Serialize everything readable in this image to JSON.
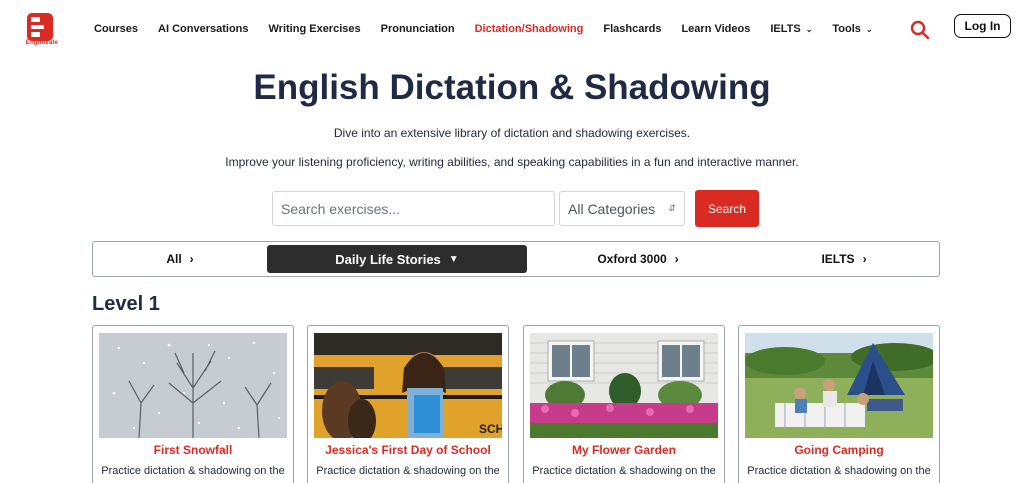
{
  "brand": {
    "name": "Engnovate",
    "accent": "#d92b22"
  },
  "nav": {
    "items": [
      {
        "label": "Courses"
      },
      {
        "label": "AI Conversations"
      },
      {
        "label": "Writing Exercises"
      },
      {
        "label": "Pronunciation"
      },
      {
        "label": "Dictation/Shadowing"
      },
      {
        "label": "Flashcards"
      },
      {
        "label": "Learn Videos"
      },
      {
        "label": "IELTS"
      },
      {
        "label": "Tools"
      }
    ],
    "login_label": "Log In"
  },
  "hero": {
    "title": "English Dictation & Shadowing",
    "subtitle1": "Dive into an extensive library of dictation and shadowing exercises.",
    "subtitle2": "Improve your listening proficiency, writing abilities, and speaking capabilities in a fun and interactive manner."
  },
  "search": {
    "placeholder": "Search exercises...",
    "category_value": "All Categories",
    "button_label": "Search"
  },
  "tabs": [
    {
      "label": "All"
    },
    {
      "label": "Daily Life Stories"
    },
    {
      "label": "Oxford 3000"
    },
    {
      "label": "IELTS"
    }
  ],
  "level_label": "Level 1",
  "cards": [
    {
      "title": "First Snowfall",
      "desc": "Practice dictation & shadowing on the"
    },
    {
      "title": "Jessica's First Day of School",
      "desc": "Practice dictation & shadowing on the"
    },
    {
      "title": "My Flower Garden",
      "desc": "Practice dictation & shadowing on the"
    },
    {
      "title": "Going Camping",
      "desc": "Practice dictation & shadowing on the"
    }
  ]
}
